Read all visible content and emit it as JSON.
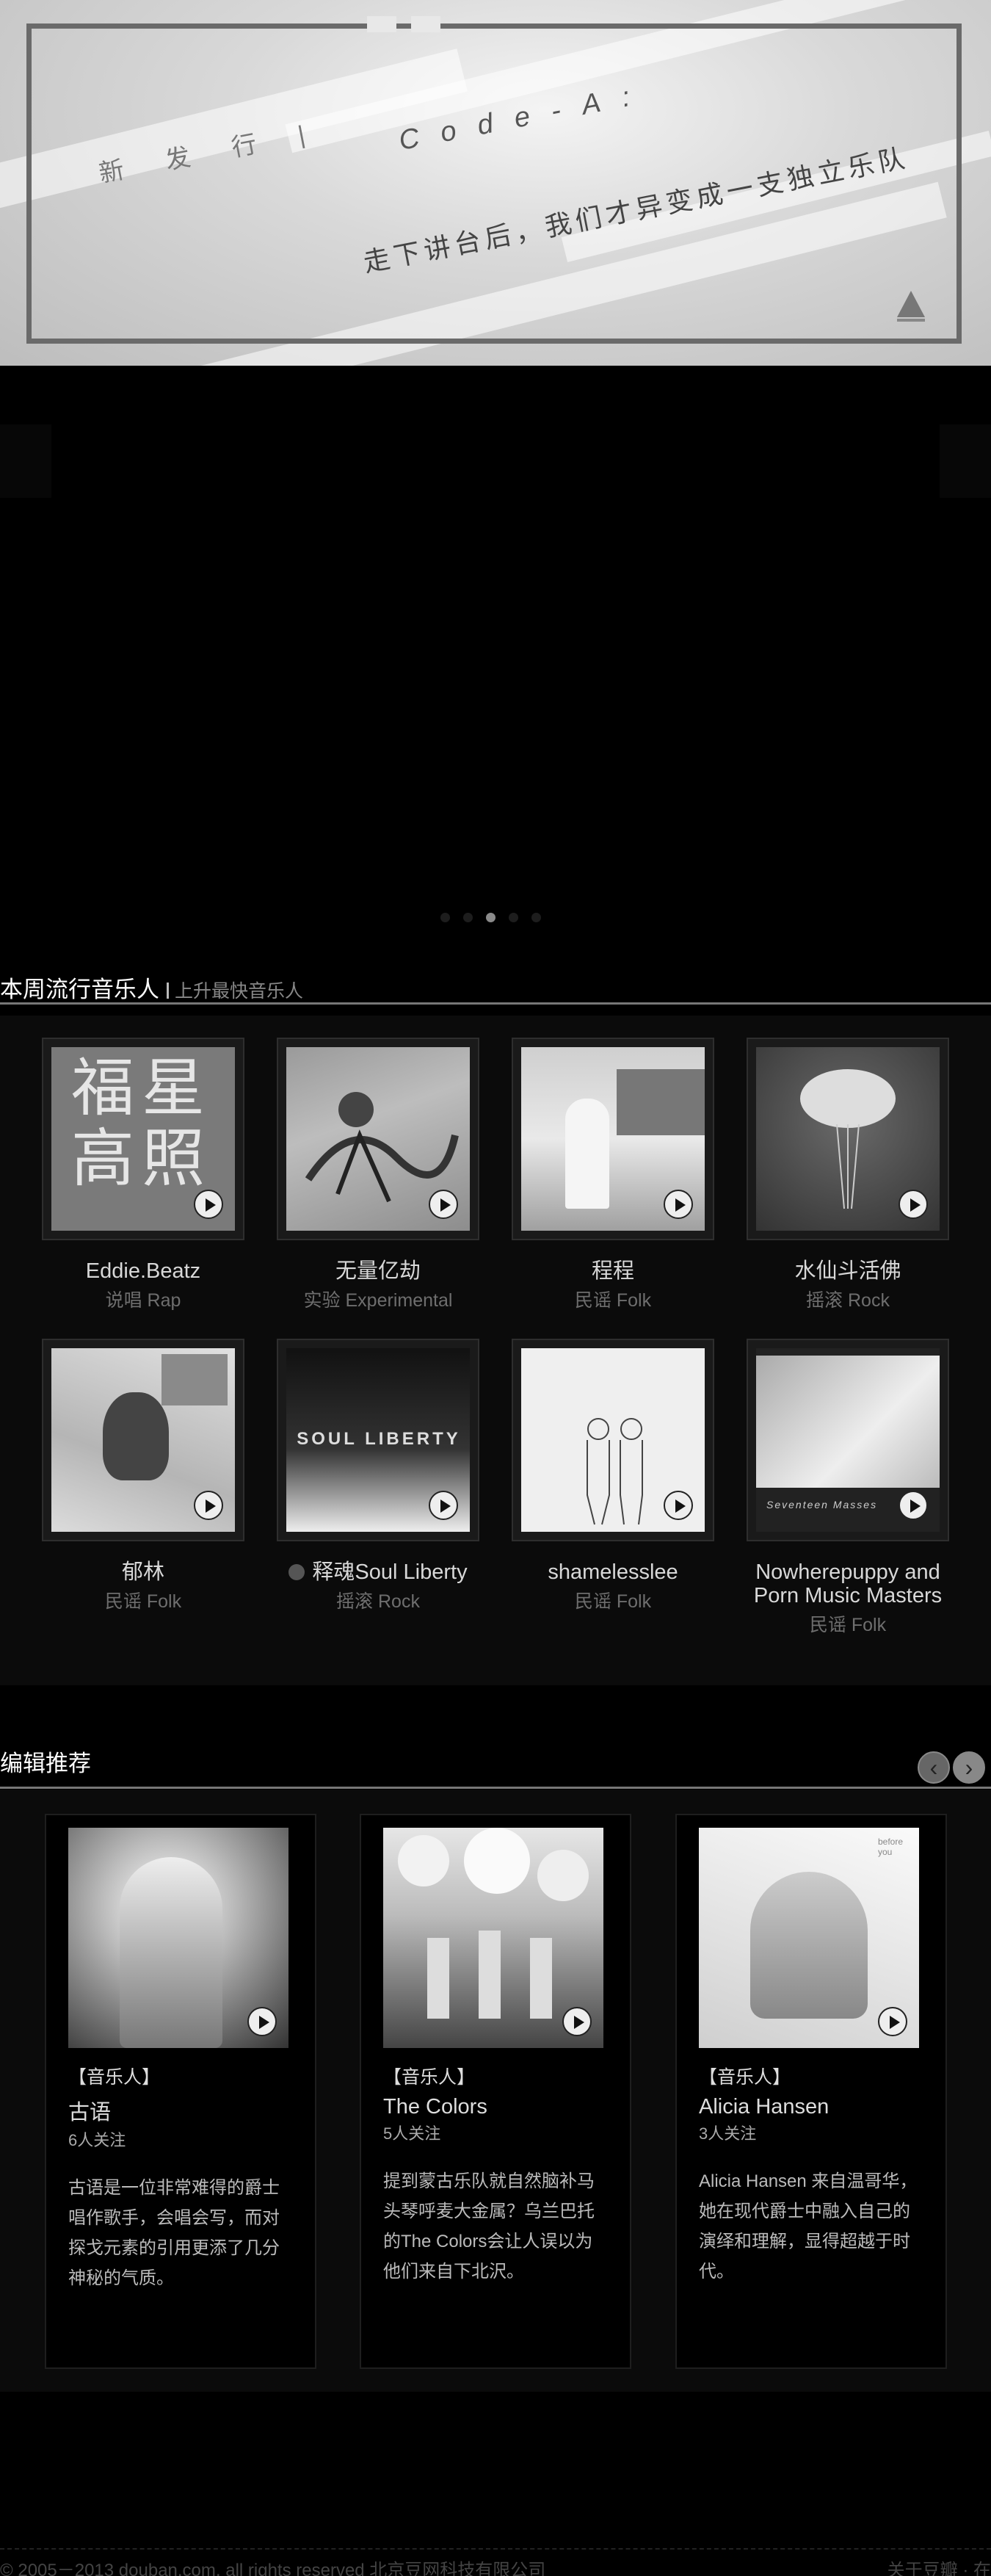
{
  "banner": {
    "tag": "新发行|",
    "code": "Code-A:",
    "subtitle": "走下讲台后，我们才异变成一支独立乐队"
  },
  "slider": {
    "dot_count": 5,
    "active_dot": 3
  },
  "weekly": {
    "title": "本周流行音乐人",
    "subtitle": "上升最快音乐人",
    "artists": [
      {
        "name": "Eddie.Beatz",
        "genre": "说唱 Rap",
        "cover_text": "福星高照"
      },
      {
        "name": "无量亿劫",
        "genre": "实验 Experimental"
      },
      {
        "name": "程程",
        "genre": "民谣 Folk"
      },
      {
        "name": "水仙斗活佛",
        "genre": "摇滚 Rock"
      },
      {
        "name": "郁林",
        "genre": "民谣 Folk"
      },
      {
        "name": "释魂Soul Liberty",
        "genre": "摇滚 Rock",
        "cover_text": "SOUL LIBERTY"
      },
      {
        "name": "shamelesslee",
        "genre": "民谣 Folk"
      },
      {
        "name": "Nowherepuppy and Porn Music Masters",
        "genre": "民谣 Folk",
        "cover_text": "Seventeen Masses"
      }
    ]
  },
  "picks": {
    "title": "编辑推荐",
    "prev_icon": "‹",
    "next_icon": "›",
    "items": [
      {
        "kind": "【音乐人】",
        "name": "古语",
        "followers": "6人关注",
        "desc": "古语是一位非常难得的爵士唱作歌手，会唱会写，而对探戈元素的引用更添了几分神秘的气质。"
      },
      {
        "kind": "【音乐人】",
        "name": "The Colors",
        "followers": "5人关注",
        "desc": "提到蒙古乐队就自然脑补马头琴呼麦大金属？乌兰巴托的The Colors会让人误以为他们来自下北沢。"
      },
      {
        "kind": "【音乐人】",
        "name": "Alicia Hansen",
        "followers": "3人关注",
        "desc": "Alicia Hansen 来自温哥华，她在现代爵士中融入自己的演绎和理解，显得超越于时代。",
        "cover_text": "before you"
      }
    ]
  },
  "footer": {
    "copyright": "© 2005－2013 douban.com, all rights reserved 北京豆网科技有限公司",
    "links": "关于豆瓣 · 在"
  }
}
